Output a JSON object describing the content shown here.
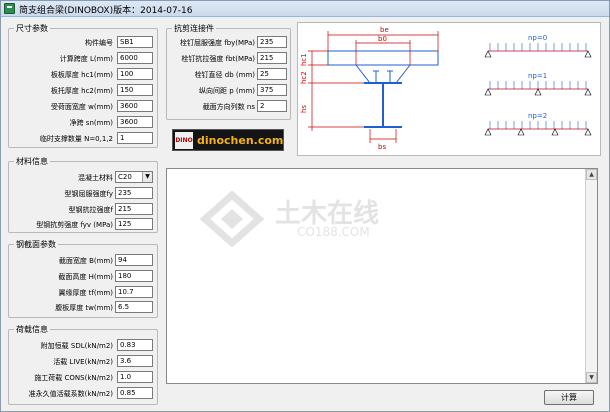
{
  "window": {
    "title": "简支组合梁(DINOBOX)版本：2014-07-16"
  },
  "size_params": {
    "group_label": "尺寸参数",
    "fields": [
      {
        "label": "构件编号",
        "value": "SB1"
      },
      {
        "label": "计算跨度 L(mm)",
        "value": "6000"
      },
      {
        "label": "板板厚度 hc1(mm)",
        "value": "100"
      },
      {
        "label": "板托厚度 hc2(mm)",
        "value": "150"
      },
      {
        "label": "受荷面宽度 w(mm)",
        "value": "3600"
      },
      {
        "label": "净跨 sn(mm)",
        "value": "3600"
      },
      {
        "label": "临时支撑数量 N=0,1,2",
        "value": "1"
      }
    ]
  },
  "shear_conn": {
    "group_label": "抗剪连接件",
    "fields": [
      {
        "label": "栓钉屈服强度 fby(MPa)",
        "value": "235"
      },
      {
        "label": "栓钉抗拉强度 fbt(MPa)",
        "value": "215"
      },
      {
        "label": "栓钉直径 db (mm)",
        "value": "25"
      },
      {
        "label": "纵向间距 p (mm)",
        "value": "375"
      },
      {
        "label": "截面方向列数 ns",
        "value": "2"
      }
    ]
  },
  "logo": {
    "mark": "DINO",
    "text": "dinochen.com"
  },
  "material": {
    "group_label": "材料信息",
    "concrete_label": "混凝土材料",
    "concrete_value": "C20",
    "fields": [
      {
        "label": "型钢屈服强度fy",
        "value": "235"
      },
      {
        "label": "型钢抗拉强度f",
        "value": "215"
      },
      {
        "label": "型钢抗剪强度 fyv (MPa)",
        "value": "125"
      }
    ]
  },
  "steel_section": {
    "group_label": "钢截面参数",
    "fields": [
      {
        "label": "截面宽度 B(mm)",
        "value": "94"
      },
      {
        "label": "截面高度 H(mm)",
        "value": "180"
      },
      {
        "label": "翼缘厚度 tf(mm)",
        "value": "10.7"
      },
      {
        "label": "腹板厚度 tw(mm)",
        "value": "6.5"
      }
    ]
  },
  "loads": {
    "group_label": "荷载信息",
    "fields": [
      {
        "label": "附加恒载 SDL(kN/m2)",
        "value": "0.83"
      },
      {
        "label": "活载 LIVE(kN/m2)",
        "value": "3.6"
      },
      {
        "label": "施工荷载 CONS(kN/m2)",
        "value": "1.0"
      },
      {
        "label": "准永久值活载系数(kN/m2)",
        "value": "0.85"
      }
    ]
  },
  "diagram": {
    "labels": {
      "be": "be",
      "b0": "b0",
      "hc1": "hc1",
      "hc2": "hc2",
      "hs": "hs",
      "bs": "bs"
    },
    "beams": [
      "np=0",
      "np=1",
      "np=2"
    ]
  },
  "watermark": {
    "text": "土木在线",
    "sub": "CO188.COM"
  },
  "calc_button": {
    "label": "计算"
  },
  "colors": {
    "diagram_red": "#cc0000",
    "diagram_blue": "#1f5fd6",
    "logo_gold": "#f3b21a"
  }
}
